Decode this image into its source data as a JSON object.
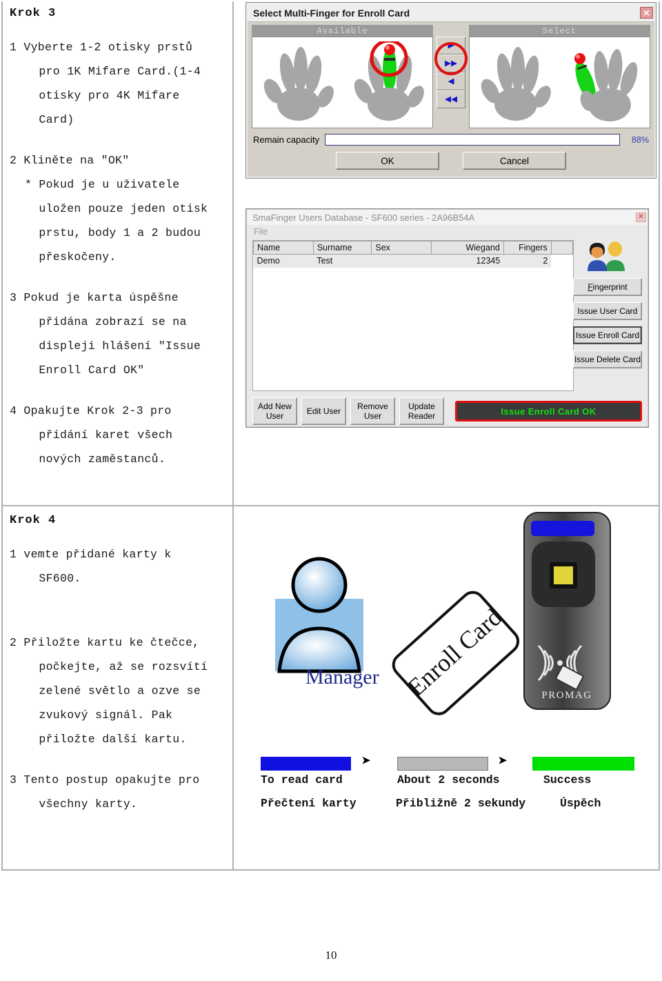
{
  "document": {
    "page_number": "10"
  },
  "steps": [
    {
      "heading": "Krok 3",
      "paragraphs": [
        "1 Vyberte 1-2 otisky prstů\n  pro 1K Mifare Card.(1-4\n  otisky pro 4K Mifare\n  Card)",
        "2 Kliněte na \"OK\"\n* Pokud je u uživatele\n  uložen pouze jeden otisk\n  prstu, body 1 a 2 budou\n  přeskočeny.",
        "3 Pokud je karta úspěšne\n  přidána zobrazí se na\n  displeji hlášení \"Issue\n  Enroll Card OK\"",
        "4 Opakujte Krok 2-3 pro\n  přidání karet všech\n  nových zaměstanců."
      ]
    },
    {
      "heading": "Krok 4",
      "paragraphs": [
        "1 vemte přidané karty k\n  SF600.",
        "2 Přiložte kartu ke čtečce,\n  počkejte, až se rozsvítí\n  zelené světlo a ozve se\n  zvukový signál. Pak\n  přiložte další kartu.",
        "3 Tento postup opakujte pro\n  všechny karty."
      ]
    }
  ],
  "finger_dialog": {
    "title": "Select Multi-Finger for Enroll Card",
    "close_label": "✕",
    "available_header": "Available",
    "select_header": "Select",
    "transfer_buttons": [
      {
        "name": "move-right",
        "glyph": "▶"
      },
      {
        "name": "move-all-right",
        "glyph": "▶▶"
      },
      {
        "name": "move-left",
        "glyph": "◀"
      },
      {
        "name": "move-all-left",
        "glyph": "◀◀"
      }
    ],
    "capacity_label": "Remain capacity",
    "capacity_percent": "88%",
    "capacity_value": 88,
    "ok_label": "OK",
    "cancel_label": "Cancel"
  },
  "db_dialog": {
    "title": "SmaFinger Users Database - SF600 series - 2A96B54A",
    "close_label": "✕",
    "menu": [
      "File"
    ],
    "table": {
      "columns": [
        "Name",
        "Surname",
        "Sex",
        "Wiegand",
        "Fingers",
        ""
      ],
      "rows": [
        {
          "name": "Demo",
          "surname": "Test",
          "sex": "",
          "wiegand": "12345",
          "fingers": "2",
          "extra": ""
        }
      ]
    },
    "side_buttons": [
      {
        "prefix": "F",
        "mid": "ingerprint",
        "label": "Fingerprint",
        "focused": false
      },
      {
        "prefix": "Issue U",
        "mid": "ser Card",
        "label": "Issue User Card",
        "focused": false
      },
      {
        "prefix": "Issue E",
        "mid": "nroll Card",
        "label": "Issue Enroll Card",
        "focused": true
      },
      {
        "prefix": "Issue D",
        "mid": "elete Card",
        "label": "Issue Delete Card",
        "focused": false
      }
    ],
    "bottom_buttons": [
      {
        "line1": "Add New",
        "line2": "User"
      },
      {
        "line1": "Edit User",
        "line2": ""
      },
      {
        "line1": "Remove",
        "line2": "User"
      },
      {
        "line1": "Update",
        "line2": "Reader"
      }
    ],
    "status_message": "Issue Enroll Card OK",
    "status_color": "#14e014",
    "status_border_color": "#e01010"
  },
  "illustration": {
    "manager_label": "Manager",
    "card_label": "Enroll Card",
    "device_brand": "PROMAG"
  },
  "legend": {
    "items": [
      {
        "color": "#1010e0",
        "en": "To read card",
        "cs": "Přečtení karty"
      },
      {
        "color": "#b8b8b8",
        "en": "About 2 seconds",
        "cs": "Přibližně 2 sekundy"
      },
      {
        "color": "#00e000",
        "en": "Success",
        "cs": "Úspěch"
      }
    ],
    "arrow": "➤"
  }
}
